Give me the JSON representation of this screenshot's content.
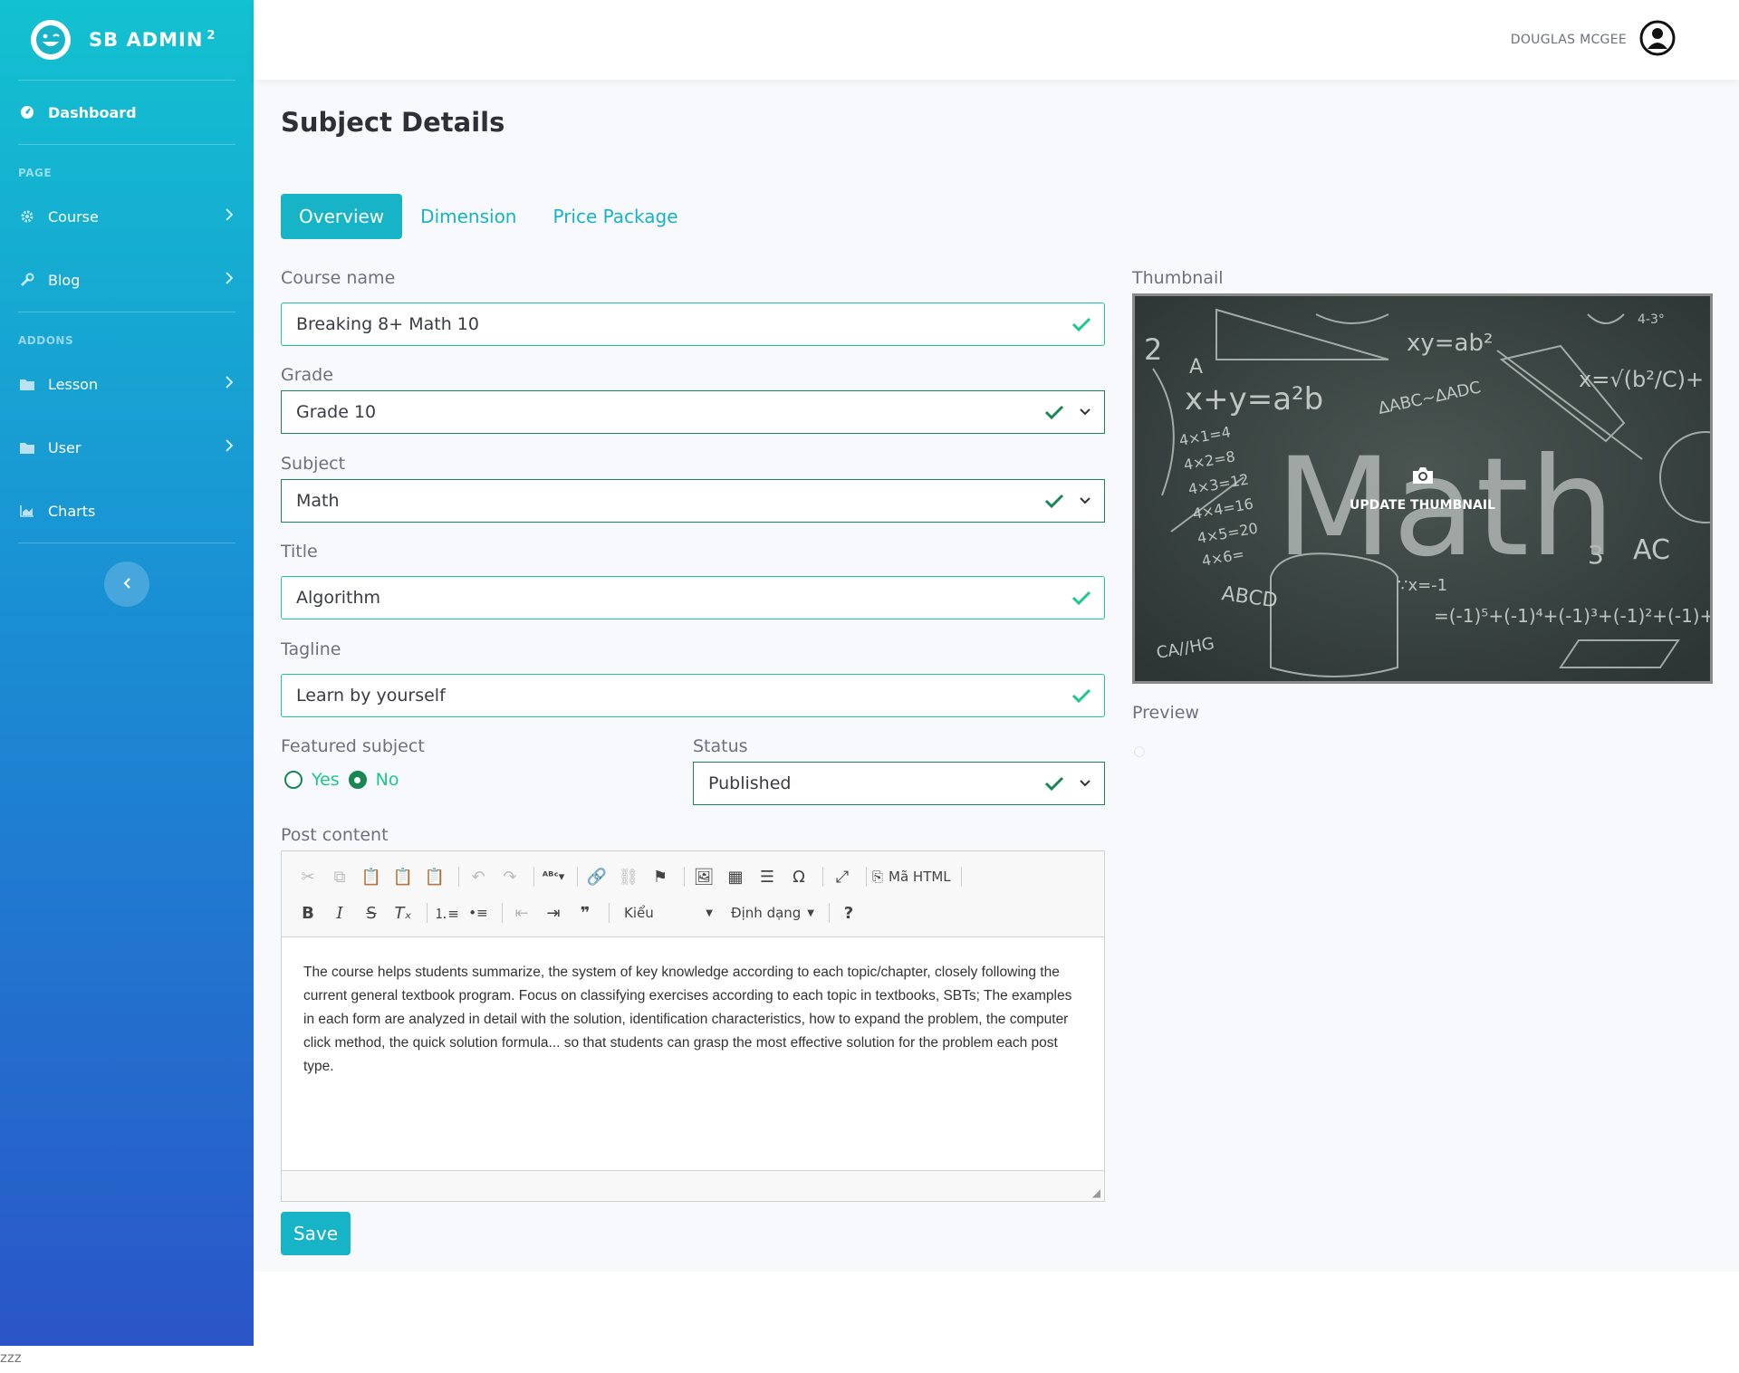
{
  "brand": {
    "name": "SB ADMIN",
    "sup": "2"
  },
  "sidebar": {
    "dashboard": "Dashboard",
    "heading_page": "PAGE",
    "heading_addons": "ADDONS",
    "items": [
      {
        "label": "Course"
      },
      {
        "label": "Blog"
      },
      {
        "label": "Lesson"
      },
      {
        "label": "User"
      },
      {
        "label": "Charts"
      }
    ]
  },
  "topbar": {
    "username": "DOUGLAS MCGEE"
  },
  "page": {
    "title": "Subject Details"
  },
  "tabs": [
    "Overview",
    "Dimension",
    "Price Package"
  ],
  "form": {
    "course_name": {
      "label": "Course name",
      "value": "Breaking 8+ Math 10"
    },
    "grade": {
      "label": "Grade",
      "value": "Grade 10"
    },
    "subject": {
      "label": "Subject",
      "value": "Math"
    },
    "title": {
      "label": "Title",
      "value": "Algorithm"
    },
    "tagline": {
      "label": "Tagline",
      "value": "Learn by yourself"
    },
    "featured": {
      "label": "Featured subject",
      "yes": "Yes",
      "no": "No",
      "selected": "No"
    },
    "status": {
      "label": "Status",
      "value": "Published"
    },
    "post_content": {
      "label": "Post content",
      "toolbar": {
        "source": "Mã HTML",
        "style": "Kiểu",
        "format": "Định dạng"
      },
      "body": "The course helps students summarize, the system of key knowledge according to each topic/chapter, closely following the current general textbook program. Focus on classifying exercises according to each topic in textbooks, SBTs; The examples in each form are analyzed in detail with the solution, identification characteristics, how to expand the problem, the computer click method, the quick solution formula... so that students can grasp the most effective solution for the problem each post type."
    },
    "save": "Save"
  },
  "thumbnail": {
    "label": "Thumbnail",
    "action": "UPDATE THUMBNAIL",
    "image": {
      "word": "Math",
      "formulas": [
        "x+y=a²b",
        "xy=ab²",
        "ΔABC~ΔADC",
        "4×1=4",
        "4×2=8",
        "4×3=12",
        "4×4=16",
        "4×5=20",
        "4×6=",
        "ABCD",
        "CA//HG",
        "x=√(b²/C)+",
        "=(-1)⁵+(-1)⁴+(-1)³+(-1)²+(-1)+",
        "∵x=-1",
        "4-3°",
        "3",
        "AC",
        "2",
        "A"
      ]
    }
  },
  "preview": {
    "label": "Preview"
  },
  "footer_note": "zzz"
}
